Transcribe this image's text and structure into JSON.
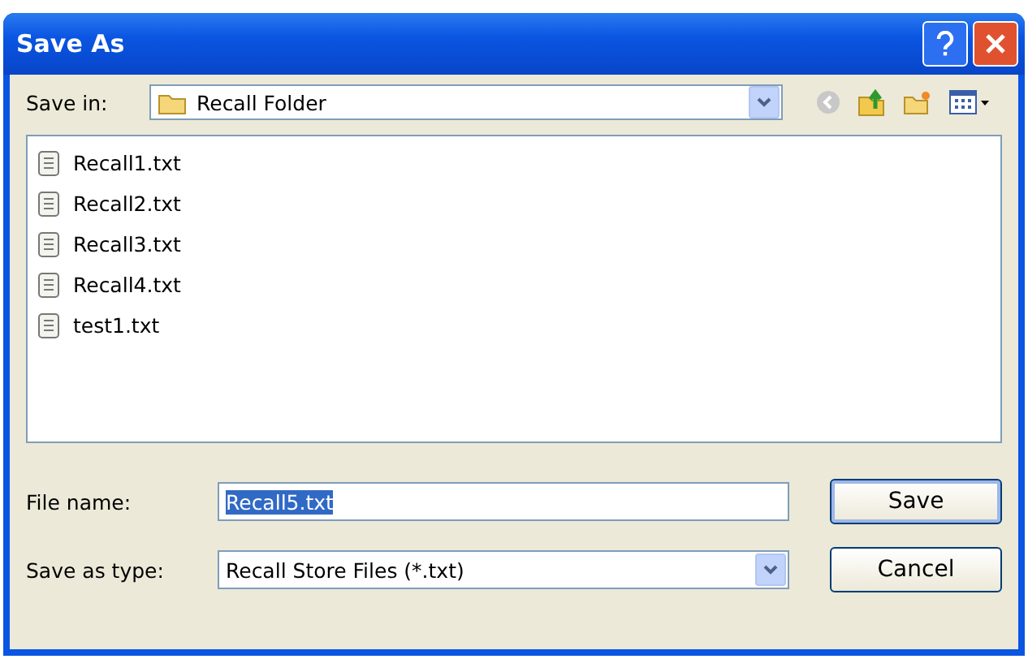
{
  "window": {
    "title": "Save As"
  },
  "save_in": {
    "label": "Save in:",
    "value": "Recall Folder"
  },
  "files": [
    {
      "name": "Recall1.txt",
      "selected": false
    },
    {
      "name": "Recall2.txt",
      "selected": false
    },
    {
      "name": "Recall3.txt",
      "selected": false
    },
    {
      "name": "Recall4.txt",
      "selected": false
    },
    {
      "name": "test1.txt",
      "selected": false
    }
  ],
  "file_name": {
    "label": "File name:",
    "value": "Recall5.txt",
    "value_selected": true
  },
  "save_as_type": {
    "label": "Save as type:",
    "value": "Recall Store Files (*.txt)"
  },
  "buttons": [
    {
      "label": "Save",
      "default": true
    },
    {
      "label": "Cancel",
      "default": false
    }
  ]
}
